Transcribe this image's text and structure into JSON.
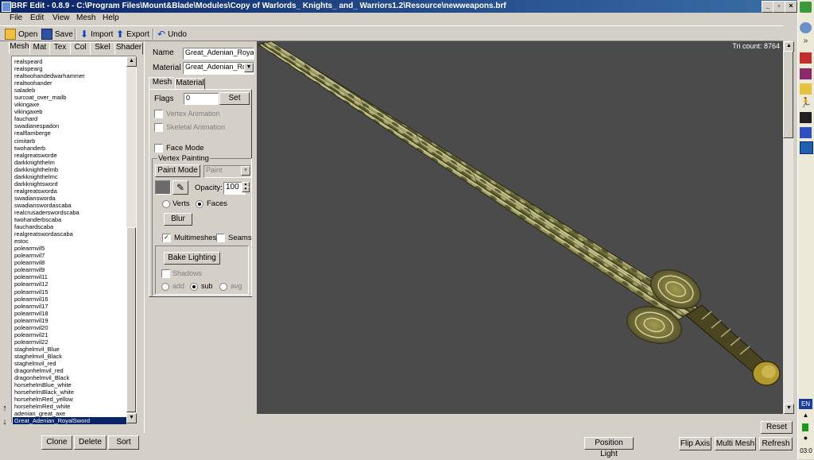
{
  "window": {
    "title": "BRF Edit - 0.8.9  -  C:\\Program Files\\Mount&Blade\\Modules\\Copy of Warlords_ Knights_ and_ Warriors1.2\\Resource\\newweapons.brf"
  },
  "menu": [
    "File",
    "Edit",
    "View",
    "Mesh",
    "Help"
  ],
  "toolbar": {
    "open": "Open",
    "save": "Save",
    "import": "Import",
    "export": "Export",
    "undo": "Undo"
  },
  "left_tabs": [
    "Mesh",
    "Mat",
    "Tex",
    "Col",
    "Skel",
    "Shader"
  ],
  "mesh_list": [
    "realspeard",
    "realspearg",
    "realtwohandedwarhammer",
    "realtwohander",
    "saladeb",
    "surcoat_over_mailb",
    "vikingaxe",
    "vikingaxeb",
    "fauchard",
    "swadianespadon",
    "realflamberge",
    "cimitarb",
    "twohanderb",
    "realgreatsworde",
    "darkknighthelm",
    "darkknighthelmb",
    "darkknighthelmc",
    "darkknightsword",
    "realgreatsworda",
    "swadiansworda",
    "swadianswordascaba",
    "realcrusaderswordscaba",
    "twohanderbscaba",
    "fauchardscaba",
    "realgreatswordascaba",
    "estoc",
    "polearmvil5",
    "polearmvil7",
    "polearmvil8",
    "polearmvil9",
    "polearmvil11",
    "polearmvil12",
    "polearmvil15",
    "polearmvil16",
    "polearmvil17",
    "polearmvil18",
    "polearmvil19",
    "polearmvil20",
    "polearmvil21",
    "polearmvil22",
    "staghelmvil_Blue",
    "staghelmvil_Black",
    "staghelmvil_red",
    "dragonhelmvil_red",
    "dragonhelmvil_Black",
    "horsehelmBlue_white",
    "horsehelmBlack_white",
    "horsehelmRed_yellow",
    "horsehelmRed_white",
    "adenian_great_axe",
    "Great_Adenian_RoyalSword"
  ],
  "list_buttons": {
    "clone": "Clone",
    "delete": "Delete",
    "sort": "Sort"
  },
  "props": {
    "name_label": "Name",
    "name_value": "Great_Adenian_Royal",
    "material_label": "Material",
    "material_value": "Great_Adenian_Ro",
    "tabs": [
      "Mesh",
      "Material"
    ],
    "flags_label": "Flags",
    "flags_value": "0",
    "set": "Set",
    "vertex_animation": "Vertex Animation",
    "skeletal_animation": "Skeletal Animation",
    "face_mode": "Face Mode",
    "vertex_painting": "Vertex Painting",
    "paint_mode": "Paint Mode",
    "paint_select": "Paint",
    "opacity_label": "Opacity:",
    "opacity_value": "100",
    "verts": "Verts",
    "faces": "Faces",
    "blur": "Blur",
    "multimeshes": "Multimeshes",
    "seams": "Seams",
    "bake_lighting": "Bake Lighting",
    "shadows": "Shadows",
    "add": "add",
    "sub": "sub",
    "avg": "avg"
  },
  "viewport": {
    "tri_count": "Tri count: 8764"
  },
  "bottom": {
    "reset": "Reset",
    "position_light": "Position Light",
    "flip_axis": "Flip Axis",
    "multi_mesh": "Multi Mesh",
    "refresh": "Refresh"
  },
  "tray": {
    "lang": "EN",
    "clock": "03:0"
  },
  "colors": {
    "title_bar": "#0a246a",
    "selection": "#0a246a",
    "viewport_bg": "#4b4b4b",
    "face_color": "#6b6b6b"
  }
}
